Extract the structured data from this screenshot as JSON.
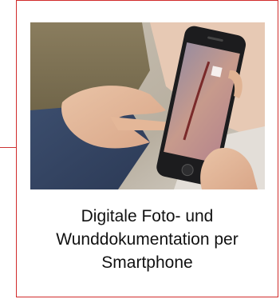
{
  "card": {
    "border_color": "#d12b2b",
    "image": {
      "description_icon": "smartphone-wound-photo-icon"
    },
    "caption_lines": [
      "Digitale Foto- und",
      "Wunddokumentation per",
      "Smartphone"
    ]
  }
}
